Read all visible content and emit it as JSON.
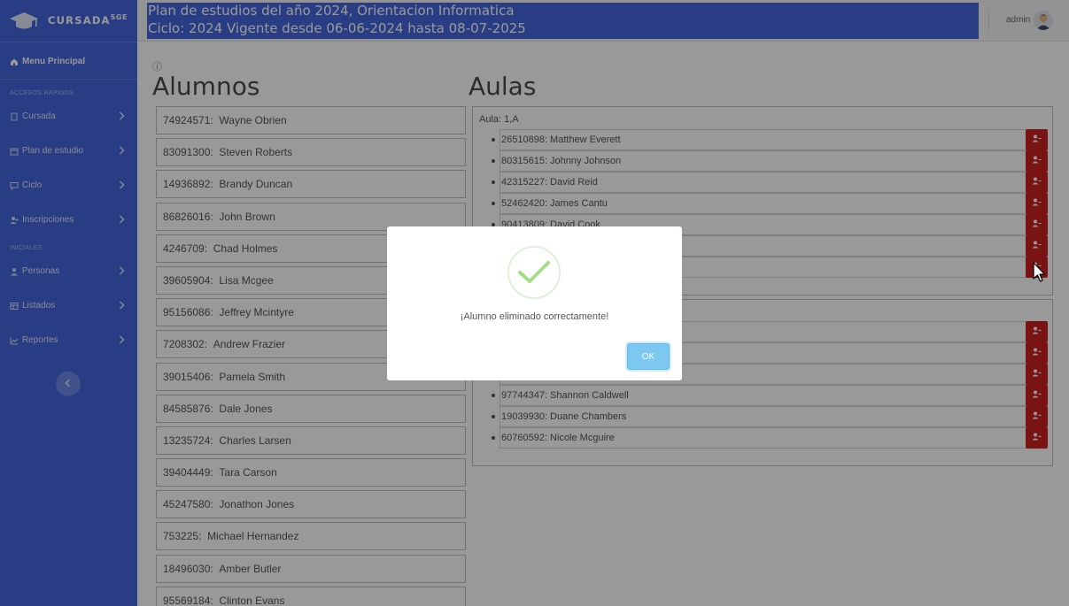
{
  "brand": {
    "name": "CURSADA",
    "suffix": "SGE"
  },
  "sidebar": {
    "main_item": "Menu Principal",
    "section_quick": "ACCESOS RAPIDOS",
    "section_initial": "INICIALES",
    "items": [
      {
        "label": "Cursada"
      },
      {
        "label": "Plan de estudio"
      },
      {
        "label": "Ciclo"
      },
      {
        "label": "Inscripciones"
      },
      {
        "label": "Personas"
      },
      {
        "label": "Listados"
      },
      {
        "label": "Reportes"
      }
    ]
  },
  "header": {
    "line1": "Plan de estudios del año 2024, Orientacion Informatica",
    "line2": "Ciclo: 2024 Vigente desde 06-06-2024 hasta 08-07-2025",
    "user": "admin"
  },
  "main": {
    "info_symbol": "ⓘ",
    "students_title": "Alumnos",
    "classrooms_title": "Aulas"
  },
  "students": [
    {
      "dni": "74924571:",
      "name": "Wayne Obrien"
    },
    {
      "dni": "83091300:",
      "name": "Steven Roberts"
    },
    {
      "dni": "14936892:",
      "name": "Brandy Duncan"
    },
    {
      "dni": "86826016:",
      "name": "John Brown"
    },
    {
      "dni": "4246709:",
      "name": "Chad Holmes"
    },
    {
      "dni": "39605904:",
      "name": "Lisa Mcgee"
    },
    {
      "dni": "95156086:",
      "name": "Jeffrey Mcintyre"
    },
    {
      "dni": "7208302:",
      "name": "Andrew Frazier"
    },
    {
      "dni": "39015406:",
      "name": "Pamela Smith"
    },
    {
      "dni": "84585876:",
      "name": "Dale Jones"
    },
    {
      "dni": "13235724:",
      "name": "Charles Larsen"
    },
    {
      "dni": "39404449:",
      "name": "Tara Carson"
    },
    {
      "dni": "45247580:",
      "name": "Jonathon Jones"
    },
    {
      "dni": "753225:",
      "name": "Michael Hernandez"
    },
    {
      "dni": "18496030:",
      "name": "Amber Butler"
    },
    {
      "dni": "95569184:",
      "name": "Clinton Evans"
    }
  ],
  "aulas": [
    {
      "label": "Aula: 1,A",
      "students": [
        "26510898: Matthew Everett",
        "80315615: Johnny Johnson",
        "42315227: David Reid",
        "52462420: James Cantu",
        "90413809: David Cook",
        "",
        ""
      ]
    },
    {
      "label": "",
      "students": [
        "",
        "",
        "",
        "97744347: Shannon Caldwell",
        "19039930: Duane Chambers",
        "60760592: Nicole Mcguire"
      ]
    }
  ],
  "modal": {
    "message": "¡Alumno eliminado correctamente!",
    "ok_label": "OK"
  },
  "colors": {
    "sidebar": "#4466dd",
    "danger": "#cc2222",
    "success": "#a5dc86",
    "ok_button": "#7cc8f0"
  }
}
